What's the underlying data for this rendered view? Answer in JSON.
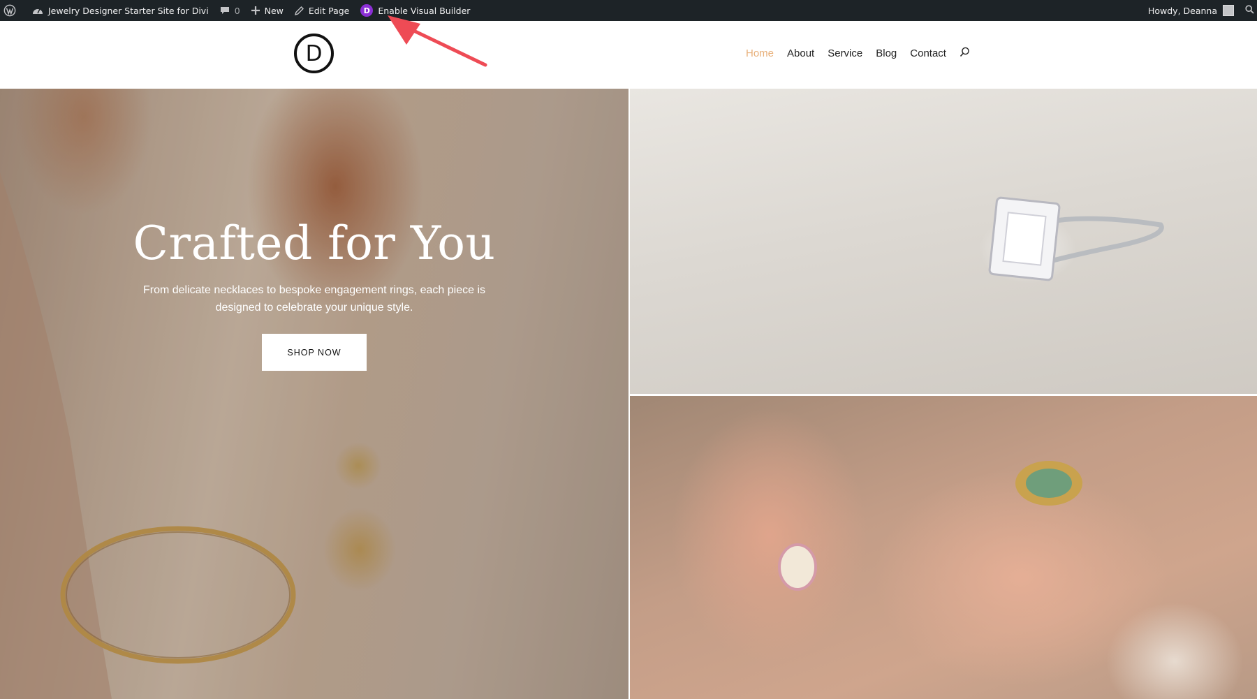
{
  "adminbar": {
    "site_name": "Jewelry Designer Starter Site for Divi",
    "comments_count": "0",
    "new_label": "New",
    "edit_label": "Edit Page",
    "visual_builder_label": "Enable Visual Builder",
    "greeting": "Howdy, Deanna",
    "divi_badge_letter": "D"
  },
  "header": {
    "logo_letter": "D",
    "nav": [
      {
        "label": "Home",
        "active": true
      },
      {
        "label": "About"
      },
      {
        "label": "Service"
      },
      {
        "label": "Blog"
      },
      {
        "label": "Contact"
      }
    ]
  },
  "hero": {
    "title": "Crafted for You",
    "subtitle": "From delicate necklaces to bespoke engagement rings, each piece is designed to celebrate your unique style.",
    "button_label": "SHOP NOW"
  },
  "colors": {
    "adminbar_bg": "#1d2327",
    "nav_active": "#e8b07a",
    "annotation_arrow": "#ee4b55",
    "divi_purple": "#8c2fd6"
  }
}
